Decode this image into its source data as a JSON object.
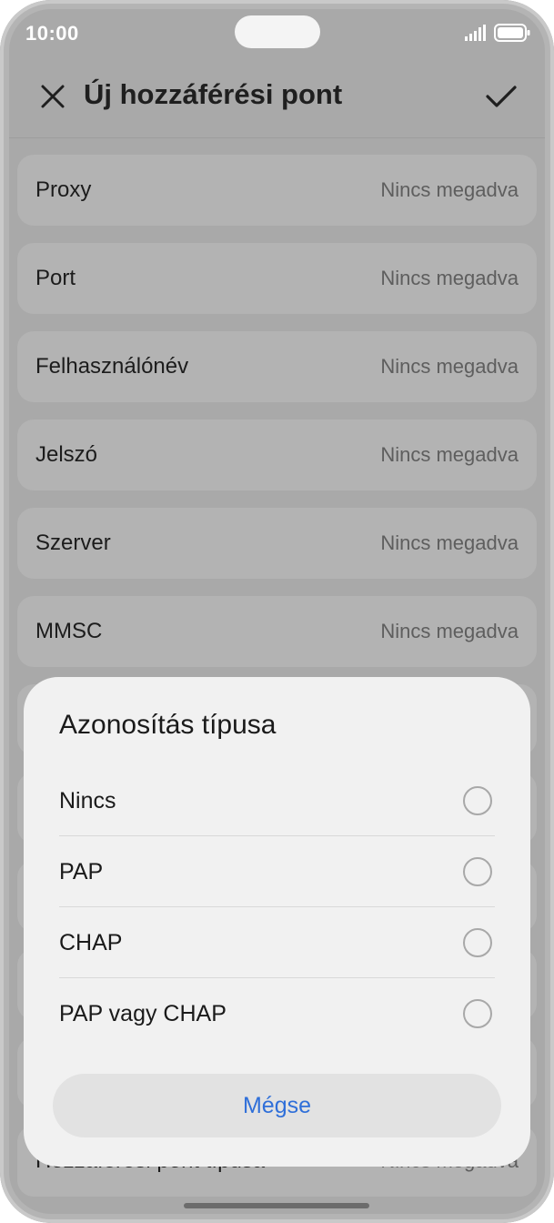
{
  "status_bar": {
    "time": "10:00"
  },
  "header": {
    "title": "Új hozzáférési pont"
  },
  "rows": [
    {
      "label": "Proxy",
      "value": "Nincs megadva"
    },
    {
      "label": "Port",
      "value": "Nincs megadva"
    },
    {
      "label": "Felhasználónév",
      "value": "Nincs megadva"
    },
    {
      "label": "Jelszó",
      "value": "Nincs megadva"
    },
    {
      "label": "Szerver",
      "value": "Nincs megadva"
    },
    {
      "label": "MMSC",
      "value": "Nincs megadva"
    },
    {
      "label": "",
      "value": ""
    },
    {
      "label": "",
      "value": ""
    },
    {
      "label": "",
      "value": ""
    },
    {
      "label": "",
      "value": ""
    },
    {
      "label": "",
      "value": ""
    },
    {
      "label": "Hozzáférési pont típusa",
      "value": "Nincs megadva"
    }
  ],
  "sheet": {
    "title": "Azonosítás típusa",
    "options": [
      {
        "label": "Nincs",
        "selected": false
      },
      {
        "label": "PAP",
        "selected": false
      },
      {
        "label": "CHAP",
        "selected": false
      },
      {
        "label": "PAP vagy CHAP",
        "selected": false
      }
    ],
    "cancel_label": "Mégse"
  },
  "colors": {
    "accent": "#2f6fd9",
    "scrim_background": "#a9a9a9",
    "sheet_background": "#f1f1f1"
  },
  "icons": [
    "close-icon",
    "check-icon",
    "signal-icon",
    "battery-icon"
  ]
}
